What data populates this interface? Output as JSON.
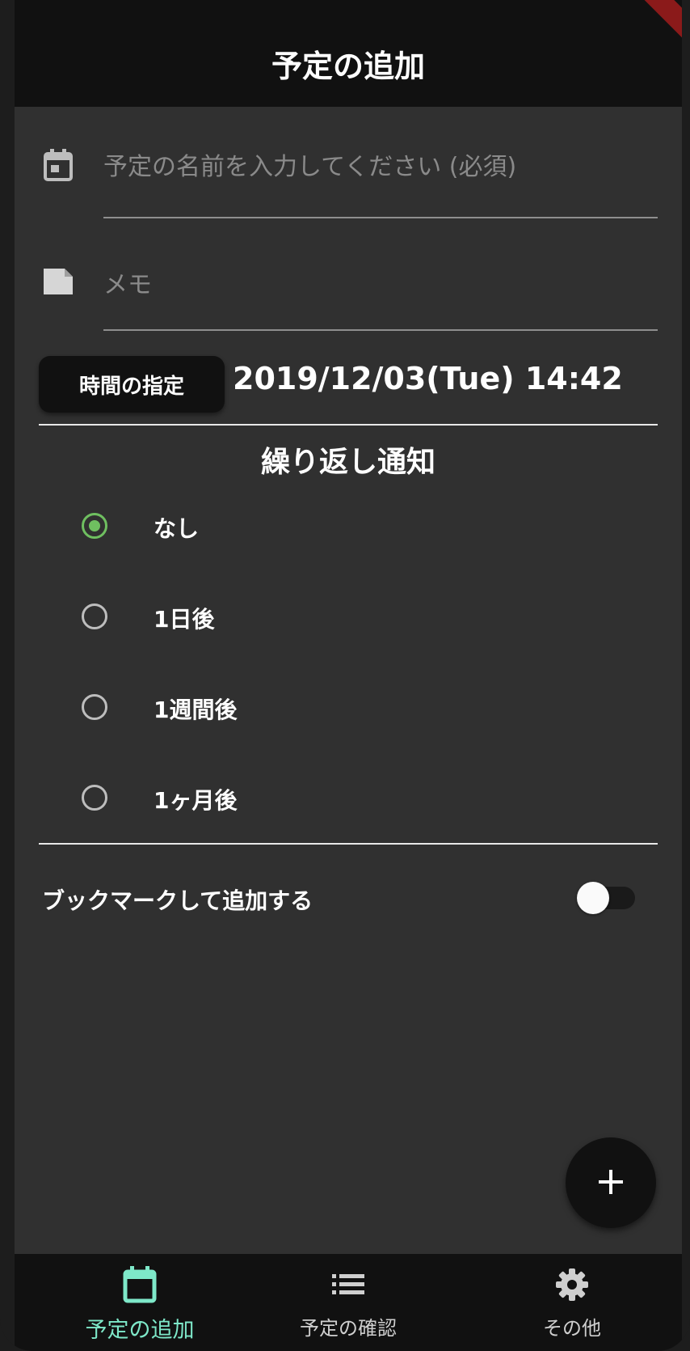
{
  "appbar": {
    "title": "予定の追加"
  },
  "form": {
    "name_placeholder": "予定の名前を入力してください (必須)",
    "memo_placeholder": "メモ",
    "time_button_label": "時間の指定",
    "datetime": "2019/12/03(Tue) 14:42"
  },
  "repeat": {
    "title": "繰り返し通知",
    "options": [
      {
        "label": "なし",
        "selected": true
      },
      {
        "label": "1日後",
        "selected": false
      },
      {
        "label": "1週間後",
        "selected": false
      },
      {
        "label": "1ヶ月後",
        "selected": false
      }
    ]
  },
  "bookmark": {
    "label": "ブックマークして追加する",
    "enabled": false
  },
  "fab": {
    "icon": "plus-icon"
  },
  "bottom_nav": {
    "items": [
      {
        "label": "予定の追加",
        "icon": "calendar-icon",
        "active": true
      },
      {
        "label": "予定の確認",
        "icon": "list-icon",
        "active": false
      },
      {
        "label": "その他",
        "icon": "gear-icon",
        "active": false
      }
    ]
  },
  "colors": {
    "accent_green": "#6fbf60",
    "nav_active": "#7ee8c9",
    "background": "#303030",
    "appbar": "#111111"
  }
}
